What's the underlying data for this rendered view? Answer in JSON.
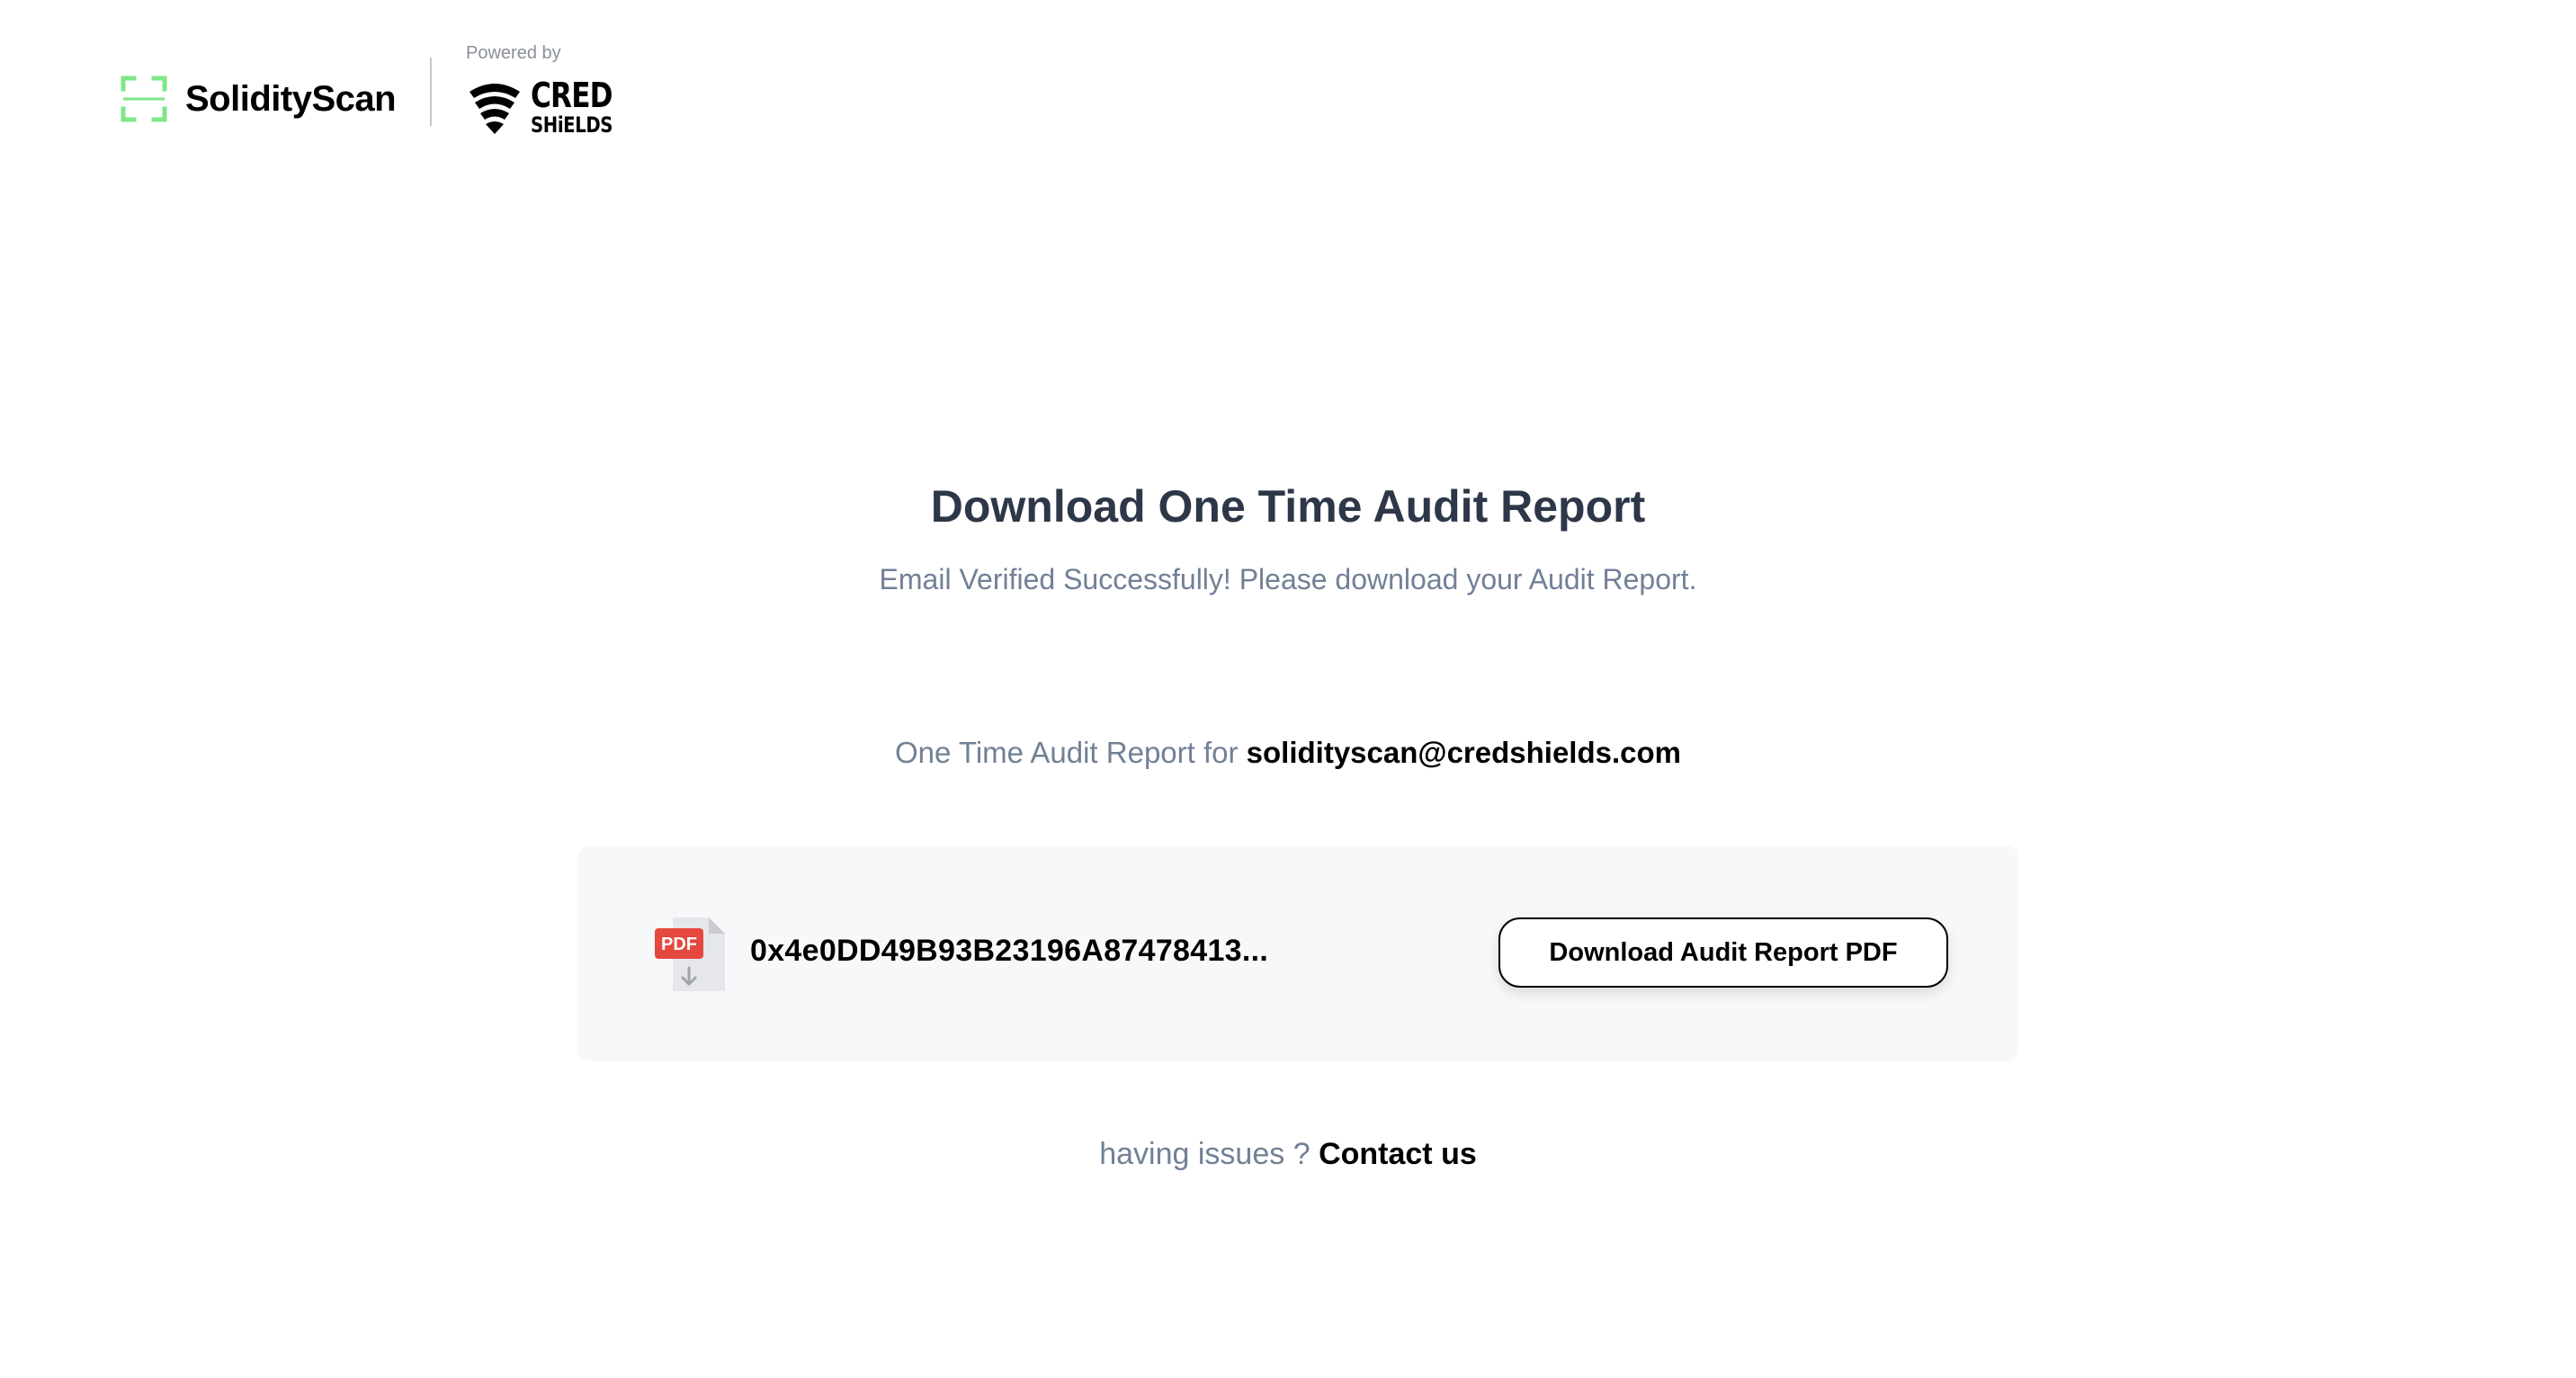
{
  "header": {
    "brand_name": "SolidityScan",
    "powered_by": "Powered by",
    "partner_line1": "CRED",
    "partner_line2": "SHiELDS",
    "brand_accent": "#7ee787"
  },
  "main": {
    "title": "Download One Time Audit Report",
    "subtitle": "Email Verified Successfully! Please download your Audit Report.",
    "report_for_label": "One Time Audit Report for",
    "email": "solidityscan@credshields.com"
  },
  "report": {
    "file_icon": "pdf-file-icon",
    "pdf_label": "PDF",
    "contract_address": "0x4e0DD49B93B23196A87478413...",
    "download_label": "Download Audit Report PDF"
  },
  "footer": {
    "issues_text": "having issues ?",
    "contact_label": "Contact us"
  },
  "colors": {
    "title": "#2d3748",
    "muted": "#718096",
    "card_bg": "#f7f8fa",
    "pdf_red": "#e5483e"
  }
}
